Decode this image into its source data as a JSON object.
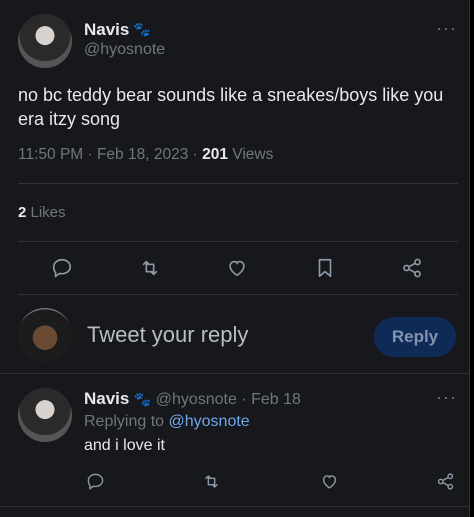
{
  "tweet": {
    "author_name": "Navis",
    "author_emoji": "🐾",
    "author_handle": "@hyosnote",
    "text": "no bc teddy bear sounds like a sneakes/boys like you era itzy song",
    "time": "11:50 PM · Feb 18, 2023 · ",
    "views_count": "201",
    "views_label": " Views",
    "likes_count": "2",
    "likes_label": " Likes",
    "more_icon": "···"
  },
  "actions": [
    "reply-icon",
    "retweet-icon",
    "like-icon",
    "bookmark-icon",
    "share-icon"
  ],
  "composer": {
    "placeholder": "Tweet your reply",
    "button_label": "Reply"
  },
  "reply": {
    "author_name": "Navis",
    "author_emoji": "🐾",
    "author_handle": "@hyosnote",
    "date": " · Feb 18",
    "replying_prefix": "Replying to ",
    "replying_handle": "@hyosnote",
    "text": "and i love it",
    "more_icon": "···"
  },
  "colors": {
    "background": "#16181c",
    "text": "#e7e9ea",
    "muted": "#71767b",
    "link": "#6fa6e8",
    "button": "#0f2a57"
  }
}
